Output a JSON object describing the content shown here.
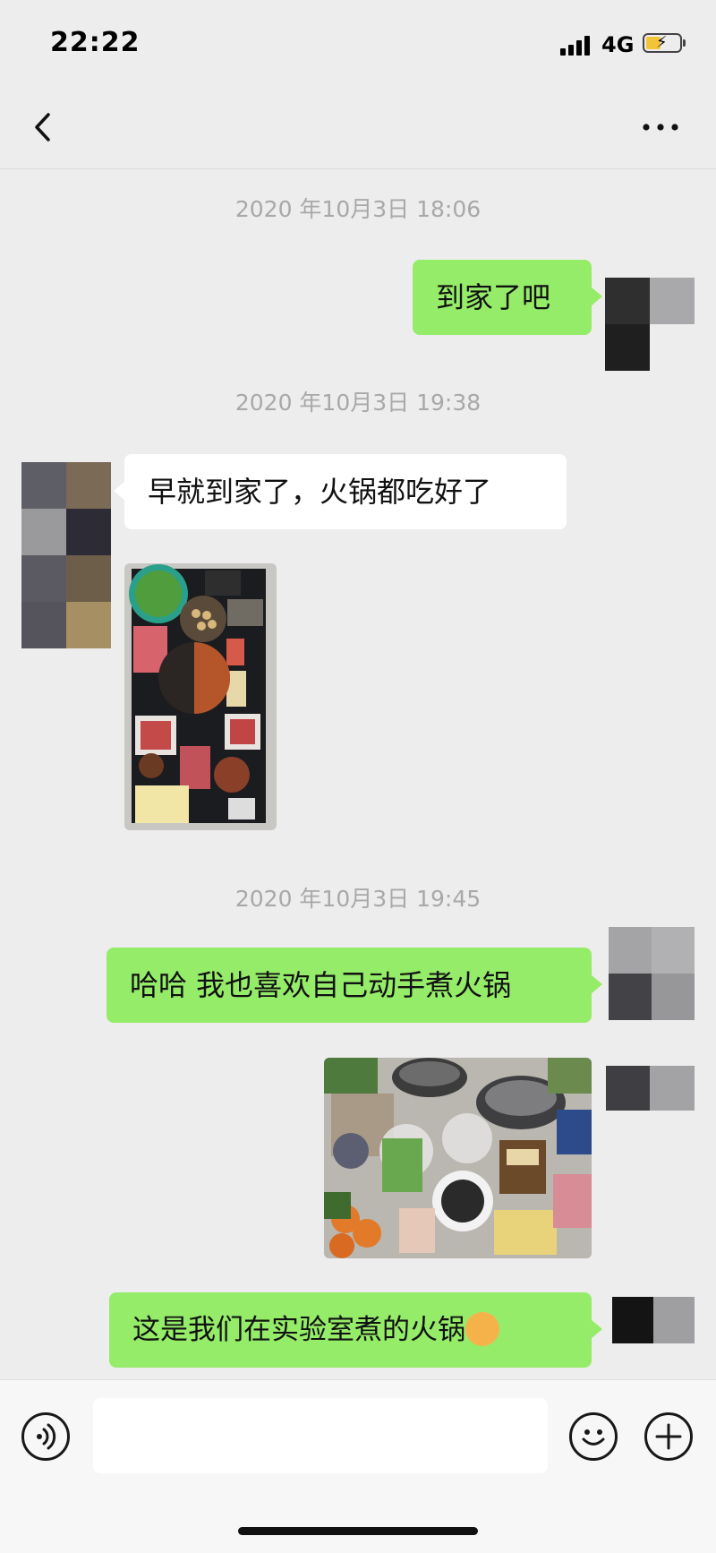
{
  "status_bar": {
    "time": "22:22",
    "network": "4G",
    "battery_charging": true
  },
  "nav": {
    "back_icon": "chevron-left-icon",
    "more_icon": "ellipsis-icon"
  },
  "chat": {
    "timestamps": [
      "2020 年10月3日 18:06",
      "2020 年10月3日 19:38",
      "2020 年10月3日 19:45"
    ],
    "messages": [
      {
        "sender": "me",
        "type": "text",
        "text": "到家了吧"
      },
      {
        "sender": "them",
        "type": "text",
        "text": "早就到家了，火锅都吃好了"
      },
      {
        "sender": "them",
        "type": "image",
        "content": "hotpot table photo"
      },
      {
        "sender": "me",
        "type": "text",
        "text": "哈哈 我也喜欢自己动手煮火锅"
      },
      {
        "sender": "me",
        "type": "image",
        "content": "lab hotpot photo"
      },
      {
        "sender": "me",
        "type": "text",
        "text": "这是我们在实验室煮的火锅",
        "emoji": "cat-face-emoji"
      }
    ]
  },
  "input_bar": {
    "voice_icon": "voice-icon",
    "emoji_icon": "emoji-icon",
    "plus_icon": "plus-icon"
  },
  "colors": {
    "background": "#ededed",
    "my_bubble": "#95ec69",
    "their_bubble": "#ffffff",
    "timestamp": "#a8a8a8"
  }
}
